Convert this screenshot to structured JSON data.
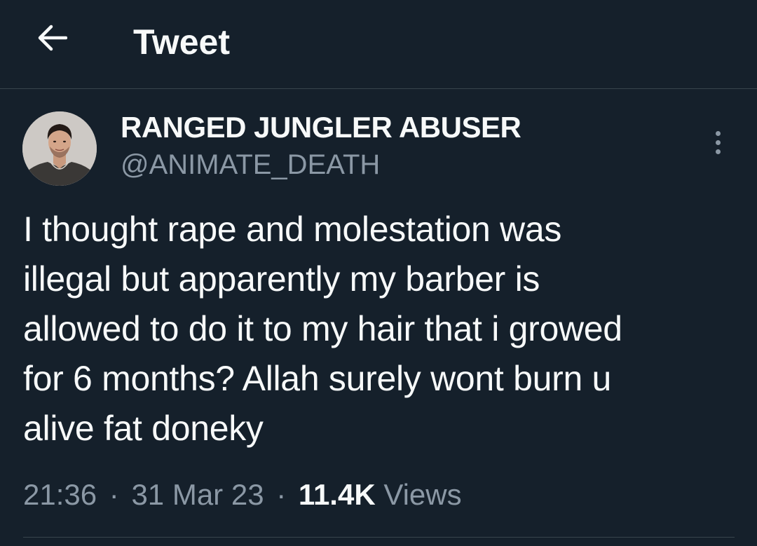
{
  "header": {
    "title": "Tweet",
    "back_icon": "arrow-left-icon"
  },
  "author": {
    "display_name": "RANGED JUNGLER ABUSER",
    "handle": "@ANIMATE_DEATH",
    "more_icon": "more-vertical-icon"
  },
  "tweet": {
    "text": "I thought rape and molestation was\nillegal but apparently my barber is\nallowed to do it to my hair that i growed\nfor 6 months? Allah surely wont burn u\nalive fat doneky"
  },
  "meta": {
    "time": "21:36",
    "date": "31 Mar 23",
    "separator": "·",
    "views_count": "11.4K",
    "views_label": "Views"
  },
  "colors": {
    "background": "#15202b",
    "text_primary": "#f7f9f9",
    "text_secondary": "#8b98a5",
    "divider": "#38444d"
  }
}
